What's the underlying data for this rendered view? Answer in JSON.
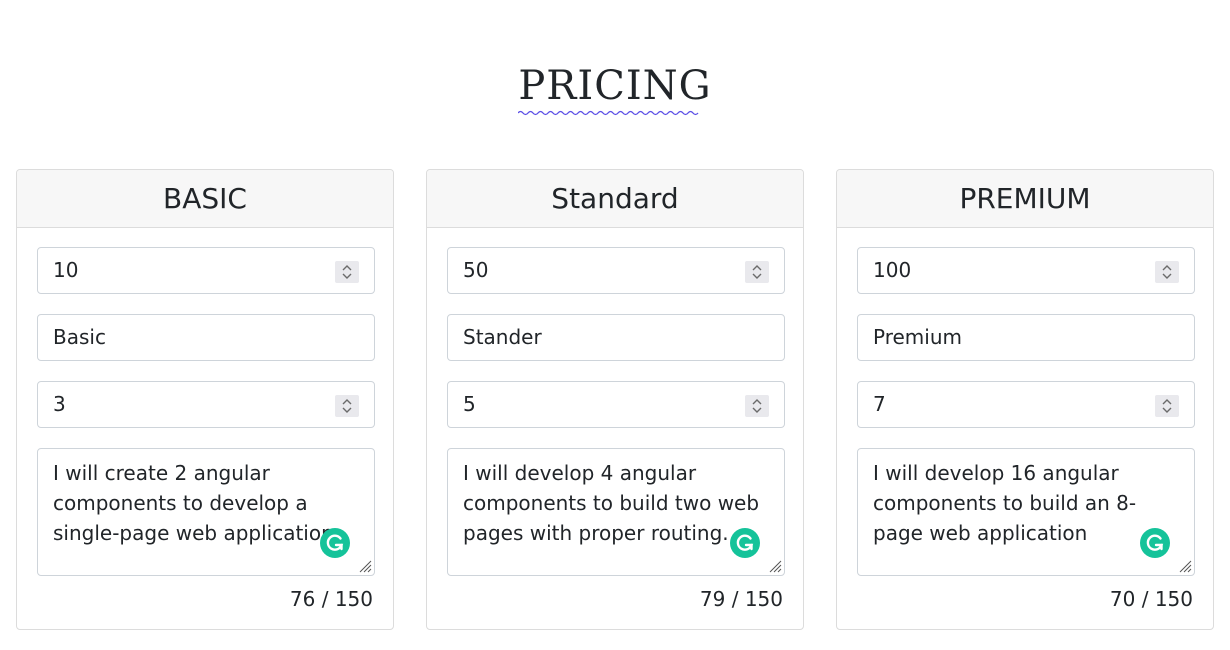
{
  "page": {
    "title": "PRICING"
  },
  "plans": [
    {
      "header": "BASIC",
      "price": "10",
      "name": "Basic",
      "days": "3",
      "description": "I will create 2 angular components to develop a single-page web application.",
      "counter": "76 / 150"
    },
    {
      "header": "Standard",
      "price": "50",
      "name": "Stander",
      "days": "5",
      "description": "I will develop 4 angular components to build two web pages with proper routing.",
      "counter": "79 / 150"
    },
    {
      "header": "PREMIUM",
      "price": "100",
      "name": "Premium",
      "days": "7",
      "description": "I will develop 16 angular components to build an 8-page web application",
      "counter": "70 / 150"
    }
  ],
  "icons": {
    "stepper": "stepper-arrows-icon",
    "grammarly": "grammarly-icon",
    "resize": "resize-handle-icon"
  },
  "colors": {
    "grammarly": "#15c39a",
    "spellcheck_underline": "#5b4fe6",
    "header_bg": "#f7f7f7",
    "border": "#ced4da"
  }
}
